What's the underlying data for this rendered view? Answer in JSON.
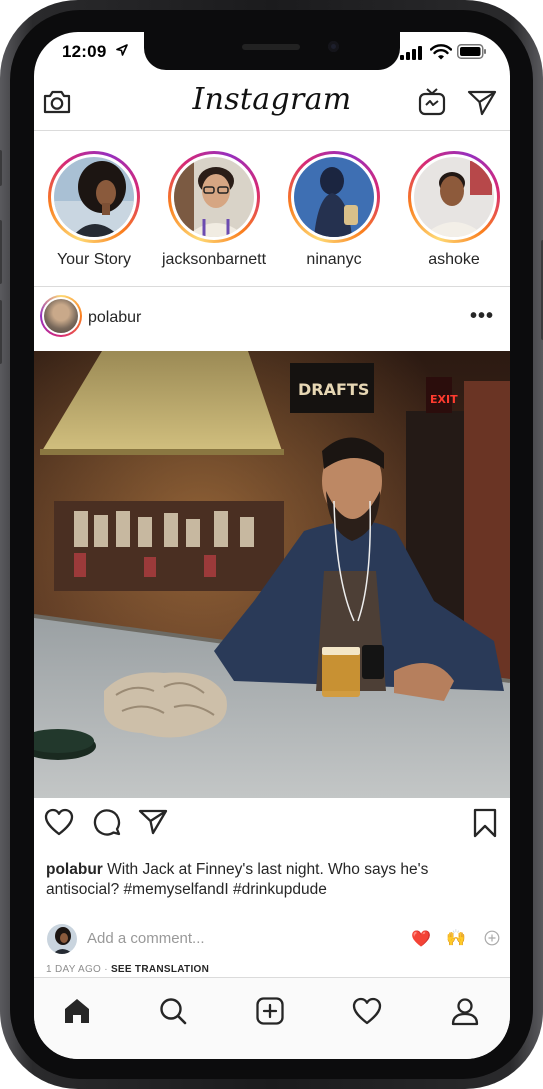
{
  "status_bar": {
    "time": "12:09"
  },
  "header": {
    "logo": "Instagram"
  },
  "stories": [
    {
      "label": "Your Story"
    },
    {
      "label": "jacksonbarnett"
    },
    {
      "label": "ninanyc"
    },
    {
      "label": "ashoke"
    }
  ],
  "post": {
    "username": "polabur",
    "more_label": "•••",
    "image_sign": "DRAFTS",
    "exit_sign": "EXIT",
    "caption_user": "polabur",
    "caption_text": " With Jack at Finney's last night. Who says he's antisocial? #memyselfandI #drinkupdude",
    "comment_placeholder": "Add a comment...",
    "quick_reactions": [
      "❤️",
      "🙌"
    ],
    "time_ago": "1 DAY AGO",
    "meta_separator": " · ",
    "see_translation": "SEE TRANSLATION"
  },
  "colors": {
    "story_ring": [
      "#feda75",
      "#fa7e1e",
      "#d62976",
      "#962fbf"
    ],
    "divider": "#dbdbdb",
    "text": "#262626",
    "muted": "#8e8e8e"
  },
  "icons": {
    "header": [
      "camera-icon",
      "igtv-icon",
      "direct-send-icon"
    ],
    "actions": [
      "heart-icon",
      "comment-icon",
      "share-icon",
      "bookmark-icon"
    ],
    "tabs": [
      "home-icon",
      "search-icon",
      "add-post-icon",
      "activity-heart-icon",
      "profile-icon"
    ]
  }
}
